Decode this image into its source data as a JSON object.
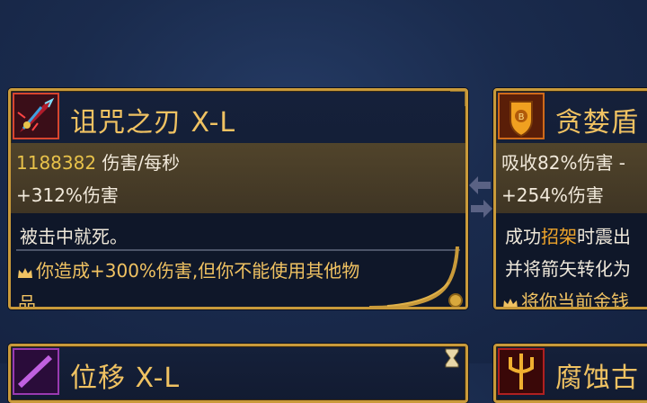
{
  "cards": [
    {
      "title": "诅咒之刃 X-L",
      "icon": "cursed-blade-icon",
      "dps_value": "1188382",
      "dps_label": " 伤害/每秒",
      "stat_bonus": "+312%伤害",
      "desc_main": "被击中就死。",
      "desc_perk_crown": "crown-icon",
      "desc_perk": "你造成+300%伤害,但你不能使用其他物",
      "desc_perk_cont": "品"
    },
    {
      "title": "贪婪盾",
      "icon": "shield-icon",
      "stat_absorb": "吸收82%伤害 -",
      "stat_bonus": "+254%伤害",
      "desc_line1_pre": "成功",
      "desc_line1_hl": "招架",
      "desc_line1_post": "时震出",
      "desc_line2": "并将箭矢转化为",
      "desc_line3": "将你当前金钱"
    }
  ],
  "bottom_cards": [
    {
      "title": "位移 X-L",
      "icon": "purple-weapon-icon"
    },
    {
      "title": "腐蚀古",
      "icon": "trident-icon"
    }
  ],
  "colors": {
    "card_border": "#c99a3a",
    "title_gold": "#f0c262",
    "dps_gold": "#e8c24a",
    "stats_bg": "#4a3f2a",
    "desc_bg": "#0f1729",
    "highlight": "#f0a52a",
    "background": "#1a2b4d"
  }
}
